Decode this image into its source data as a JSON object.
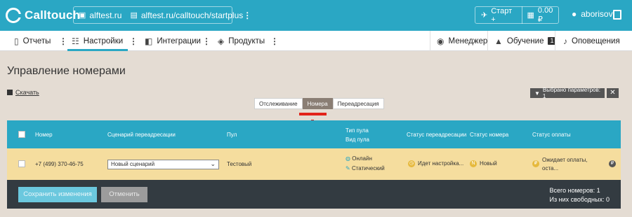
{
  "header": {
    "logo_text": "Calltouch",
    "project": {
      "site": "alftest.ru",
      "path": "alftest.ru/calltouch/startplus"
    },
    "account": {
      "tariff": "Старт +",
      "balance": "0.00 ₽"
    },
    "user": "aborisov"
  },
  "nav": {
    "items": [
      {
        "label": "Отчеты"
      },
      {
        "label": "Настройки"
      },
      {
        "label": "Интеграции"
      },
      {
        "label": "Продукты"
      }
    ],
    "right": [
      {
        "label": "Менеджер"
      },
      {
        "label": "Обучение",
        "badge": "1"
      },
      {
        "label": "Оповещения"
      }
    ]
  },
  "page": {
    "title": "Управление номерами",
    "download": "Скачать",
    "filter_label": "Выбрано параметров: 1",
    "filter_close": "✕"
  },
  "tabs": [
    "Отслеживание",
    "Номера",
    "Переадресация"
  ],
  "table": {
    "headers": {
      "number": "Номер",
      "scenario": "Сценарий переадресации",
      "pool": "Пул",
      "pool_type": "Тип пула",
      "pool_view": "Вид пула",
      "redirect_status": "Статус переадресации",
      "number_status": "Статус номера",
      "payment_status": "Статус оплаты"
    },
    "row": {
      "number": "+7 (499) 370-46-75",
      "scenario": "Новый сценарий",
      "pool": "Тестовый",
      "pool_type": "Онлайн",
      "pool_view": "Статический",
      "redirect_status": "Идет настройка...",
      "number_status": "Новый",
      "payment_status_line1": "Ожидает оплаты,",
      "payment_status_line2": "оста..."
    }
  },
  "footer": {
    "save": "Сохранить изменения",
    "cancel": "Отменить",
    "total": "Всего номеров: 1",
    "free": "Из них свободных: 0"
  },
  "colors": {
    "brand": "#2aa7c4",
    "row_highlight": "#f5dd9e",
    "annotation": "#e2231a"
  }
}
